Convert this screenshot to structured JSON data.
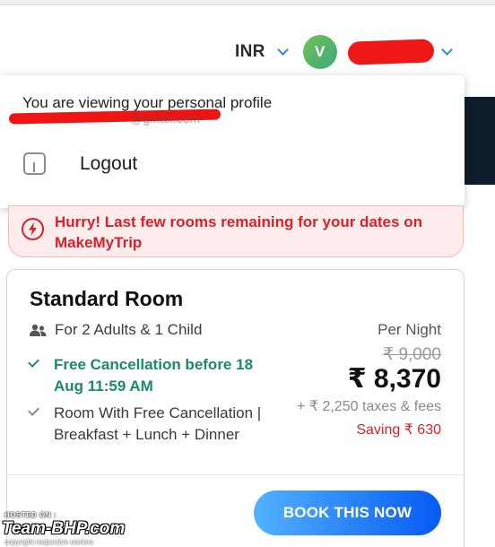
{
  "header": {
    "currency": "INR",
    "avatar_initial": "V"
  },
  "profile_menu": {
    "viewing_text": "You are viewing your personal profile",
    "email_partial": "@gmail.com",
    "logout_label": "Logout"
  },
  "alert": {
    "text": "Hurry! Last few rooms remaining for your dates on MakeMyTrip"
  },
  "room": {
    "title": "Standard Room",
    "occupancy": "For 2 Adults & 1 Child",
    "per_night_label": "Per Night",
    "features": [
      "Free Cancellation before 18 Aug 11:59 AM",
      "Room With Free Cancellation | Breakfast + Lunch + Dinner"
    ],
    "original_price": "₹ 9,000",
    "final_price": "₹ 8,370",
    "taxes": "+ ₹ 2,250 taxes & fees",
    "saving": "Saving ₹ 630",
    "book_button": "BOOK THIS NOW"
  },
  "watermark": {
    "hosted_on": "HOSTED ON :",
    "site": "Team-BHP.com",
    "copyright": "copyright respective owners"
  },
  "colors": {
    "accent_blue": "#2a8af0",
    "alert_red": "#d8212a",
    "success_green": "#1a8a6e",
    "button_gradient_start": "#53b2fe",
    "button_gradient_end": "#065af3"
  }
}
